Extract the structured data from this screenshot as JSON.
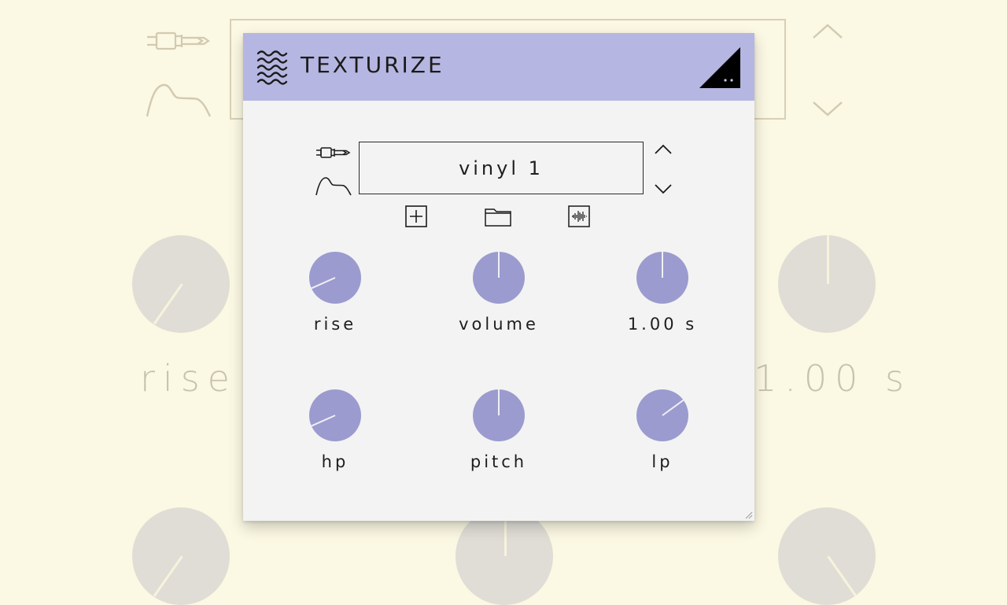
{
  "plugin": {
    "title": "TEXTURIZE",
    "preset": {
      "name": "vinyl 1"
    },
    "toolbar": {
      "new_icon": "plus-square-icon",
      "load_icon": "folder-icon",
      "sample_icon": "waveform-icon"
    },
    "knobs": [
      {
        "id": "rise",
        "label": "rise",
        "level": 0.12
      },
      {
        "id": "volume",
        "label": "volume",
        "level": 0.5
      },
      {
        "id": "time",
        "label": "1.00 s",
        "level": 0.5
      },
      {
        "id": "hp",
        "label": "hp",
        "level": 0.12
      },
      {
        "id": "pitch",
        "label": "pitch",
        "level": 0.5
      },
      {
        "id": "lp",
        "label": "lp",
        "level": 0.68
      }
    ]
  },
  "background": {
    "labels": [
      "rise",
      "1.00 s"
    ]
  },
  "colors": {
    "page_bg": "#fbf8e3",
    "header": "#b6b6e2",
    "knob": "#9b9bcf",
    "panel": "#f3f3f3"
  }
}
